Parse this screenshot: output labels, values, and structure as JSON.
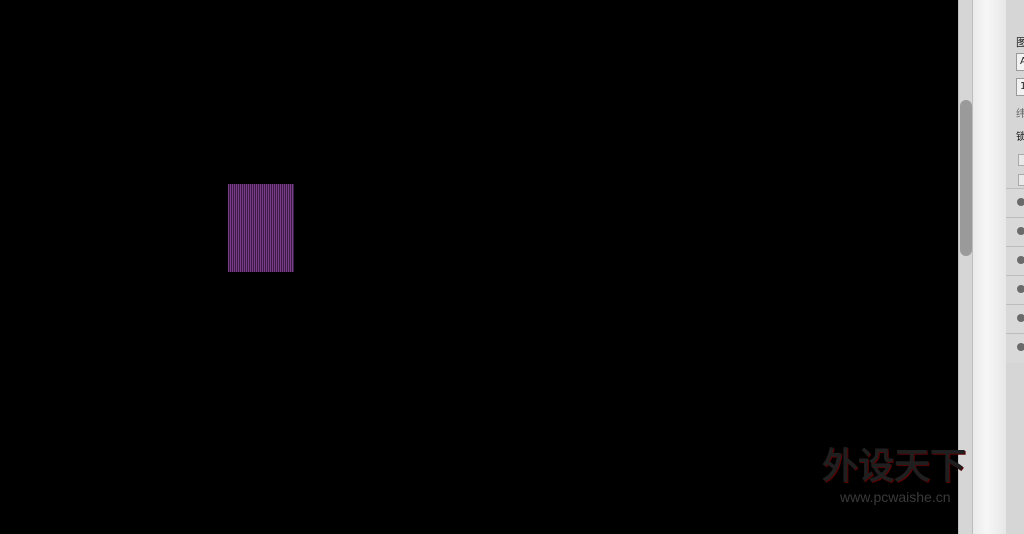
{
  "canvas": {
    "background": "#000000",
    "object_color": "#7a3d8a"
  },
  "layers_panel": {
    "blend_label": "图",
    "blend_mode": "A",
    "opacity": "1",
    "lock_label": "锁",
    "fill_label": "纬",
    "rows": [
      {
        "visible": true
      },
      {
        "visible": true
      },
      {
        "visible": true
      },
      {
        "visible": true
      },
      {
        "visible": true
      },
      {
        "visible": true
      }
    ]
  },
  "watermark": {
    "title": "外设天下",
    "url": "www.pcwaishe.cn"
  }
}
